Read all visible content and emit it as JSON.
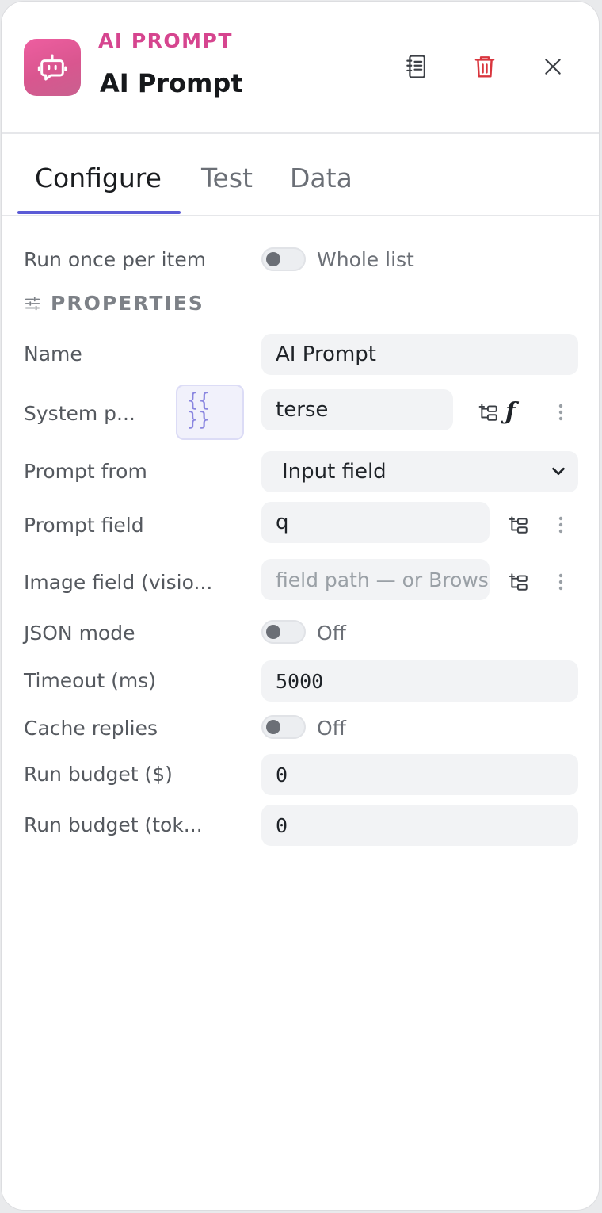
{
  "header": {
    "kind": "AI PROMPT",
    "title": "AI Prompt",
    "icons": {
      "app": "robot-icon",
      "docs": "notebook-icon",
      "delete": "trash-icon",
      "close": "close-icon"
    },
    "colors": {
      "accent": "#d6458f",
      "delete": "#d9363e",
      "tab_active": "#5b5bd6"
    }
  },
  "tabs": [
    {
      "label": "Configure",
      "active": true
    },
    {
      "label": "Test",
      "active": false
    },
    {
      "label": "Data",
      "active": false
    }
  ],
  "run_once": {
    "label": "Run once per item",
    "toggle_label": "Whole list",
    "on": false
  },
  "section": {
    "title": "PROPERTIES",
    "icon": "sliders-icon"
  },
  "fields": {
    "name": {
      "label": "Name",
      "value": "AI Prompt"
    },
    "system_prompt": {
      "label": "System p...",
      "value": "terse",
      "template_glyph_top": "{{",
      "template_glyph_bottom": "}}",
      "fx": "ƒ"
    },
    "prompt_from": {
      "label": "Prompt from",
      "value": "Input field"
    },
    "prompt_field": {
      "label": "Prompt field",
      "value": "q"
    },
    "image_field": {
      "label": "Image field (visio...",
      "placeholder": "field path — or Browse"
    },
    "json_mode": {
      "label": "JSON mode",
      "toggle_label": "Off",
      "on": false
    },
    "timeout": {
      "label": "Timeout (ms)",
      "value": "5000"
    },
    "cache": {
      "label": "Cache replies",
      "toggle_label": "Off",
      "on": false
    },
    "budget_usd": {
      "label": "Run budget ($)",
      "value": "0"
    },
    "budget_tokens": {
      "label": "Run budget (tok...",
      "value": "0"
    }
  }
}
